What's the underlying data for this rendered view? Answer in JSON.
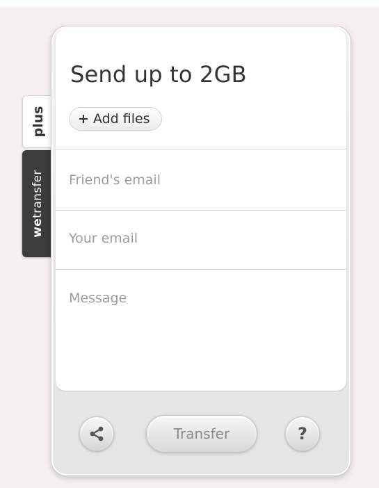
{
  "side_tabs": {
    "plus": "plus",
    "wetransfer_prefix": "we",
    "wetransfer_suffix": "transfer"
  },
  "card": {
    "title": "Send up to 2GB",
    "add_files": {
      "icon": "plus-icon",
      "icon_glyph": "+",
      "label": "Add files"
    },
    "fields": {
      "friends_email_placeholder": "Friend's email",
      "your_email_placeholder": "Your email",
      "message_placeholder": "Message"
    }
  },
  "footer": {
    "share_icon": "share-icon",
    "transfer_label": "Transfer",
    "help_glyph": "?"
  }
}
